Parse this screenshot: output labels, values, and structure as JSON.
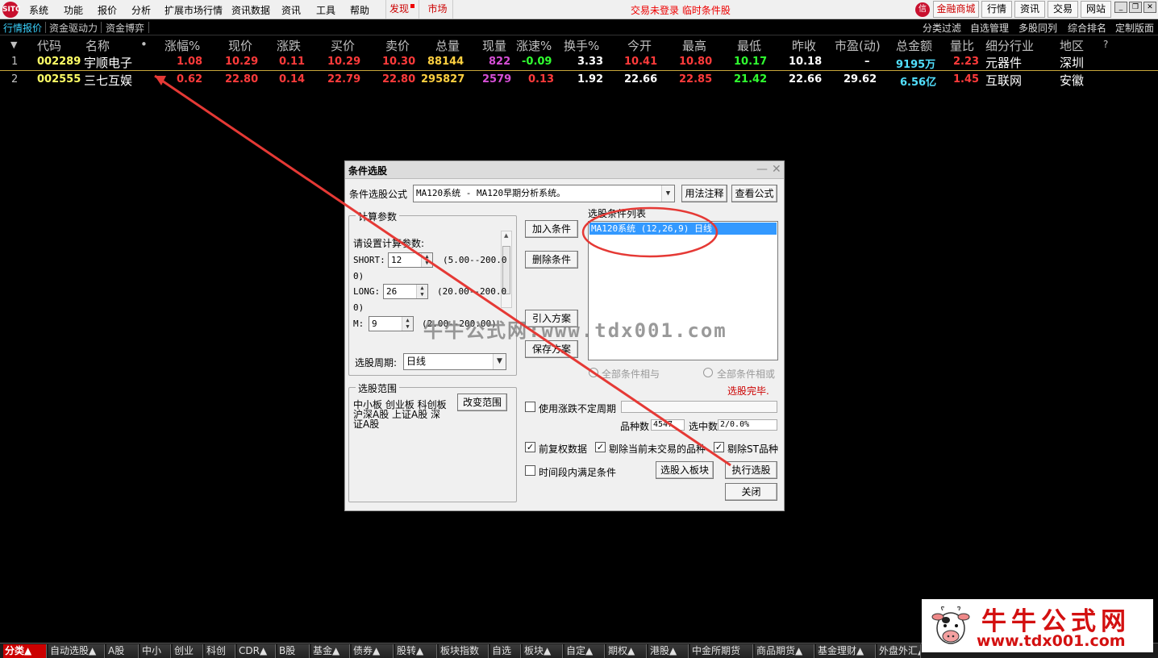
{
  "menubar": {
    "items": [
      "系统",
      "功能",
      "报价",
      "分析",
      "扩展市场行情",
      "资讯数据",
      "资讯",
      "工具",
      "帮助"
    ],
    "discover": "发现",
    "market": "市场",
    "status": "交易未登录  临时条件股",
    "jr_logo": "信",
    "right_buttons": [
      "金融商城",
      "行情",
      "资讯",
      "交易",
      "网站"
    ],
    "logo": "SITC"
  },
  "subbar": {
    "tabs": [
      "行情报价",
      "资金驱动力",
      "资金博弈"
    ],
    "right": [
      "分类过滤",
      "自选管理",
      "多股同列",
      "综合排名",
      "定制版面"
    ]
  },
  "table": {
    "headers": [
      "代码",
      "名称",
      "•",
      "涨幅%",
      "现价",
      "涨跌",
      "买价",
      "卖价",
      "总量",
      "现量",
      "涨速%",
      "换手%",
      "今开",
      "最高",
      "最低",
      "昨收",
      "市盈(动)",
      "总金额",
      "量比",
      "细分行业",
      "地区",
      "?"
    ],
    "rows": [
      {
        "idx": "1",
        "code": "002289",
        "name": "宇顺电子",
        "chg_pct": "1.08",
        "price": "10.29",
        "chg": "0.11",
        "bid": "10.29",
        "ask": "10.30",
        "volume": "88144",
        "cur_vol": "822",
        "speed": "-0.09",
        "turnover": "3.33",
        "open": "10.41",
        "high": "10.80",
        "low": "10.17",
        "prev": "10.18",
        "pe": "–",
        "amount": "9195万",
        "vol_ratio": "2.23",
        "industry": "元器件",
        "region": "深圳"
      },
      {
        "idx": "2",
        "code": "002555",
        "name": "三七互娱",
        "chg_pct": "0.62",
        "price": "22.80",
        "chg": "0.14",
        "bid": "22.79",
        "ask": "22.80",
        "volume": "295827",
        "cur_vol": "2579",
        "speed": "0.13",
        "turnover": "1.92",
        "open": "22.66",
        "high": "22.85",
        "low": "21.42",
        "prev": "22.66",
        "pe": "29.62",
        "amount": "6.56亿",
        "vol_ratio": "1.45",
        "industry": "互联网",
        "region": "安徽"
      }
    ]
  },
  "dialog": {
    "title": "条件选股",
    "formula_label": "条件选股公式",
    "formula_value": "MA120系统    - MA120早期分析系统。",
    "usage_btn": "用法注释",
    "view_btn": "查看公式",
    "params_group": "计算参数",
    "params_prompt": "请设置计算参数:",
    "params": [
      {
        "name": "SHORT:",
        "value": "12",
        "range_a": "(5.00--200.0",
        "range_b": "0)"
      },
      {
        "name": "LONG:",
        "value": "26",
        "range_a": "(20.00--200.0",
        "range_b": "0)"
      },
      {
        "name": "M:",
        "value": "9",
        "range_a": "(2.00--200.00)",
        "range_b": ""
      }
    ],
    "period_label": "选股周期:",
    "period_value": "日线",
    "add_btn": "加入条件",
    "del_btn": "删除条件",
    "import_btn": "引入方案",
    "save_btn": "保存方案",
    "list_label": "选股条件列表",
    "list_items": [
      "MA120系统 (12,26,9) 日线"
    ],
    "all_and": "全部条件相与",
    "all_or": "全部条件相或",
    "done": "选股完毕.",
    "range_group": "选股范围",
    "range_text_1": "中小板 创业板 科创板",
    "range_text_2": "沪深A股 上证A股 深",
    "range_text_3": "证A股",
    "change_range_btn": "改变范围",
    "use_period": "使用涨跌不定周期",
    "count_label": "品种数",
    "count_value": "4547",
    "selected_label": "选中数",
    "selected_value": "2/0.0%",
    "fq": "前复权数据",
    "excl_untraded": "剔除当前未交易的品种",
    "excl_st": "剔除ST品种",
    "time_cond": "时间段内满足条件",
    "to_block_btn": "选股入板块",
    "run_btn": "执行选股",
    "close_btn": "关闭",
    "watermark": "牛牛公式网:www.tdx001.com"
  },
  "bottom_tabs": [
    "分类▲",
    "自动选股▲",
    "A股",
    "中小",
    "创业",
    "科创",
    "CDR▲",
    "B股",
    "基金▲",
    "债券▲",
    "股转▲",
    "板块指数",
    "自选",
    "板块▲",
    "自定▲",
    "期权▲",
    "港股▲",
    "中金所期货",
    "商品期货▲",
    "基金理财▲",
    "外盘外汇▲"
  ],
  "badge": {
    "title": "牛牛公式网",
    "url": "www.tdx001.com"
  },
  "colors": {
    "accent": "#3399ff",
    "annotation_red": "#e53935"
  }
}
